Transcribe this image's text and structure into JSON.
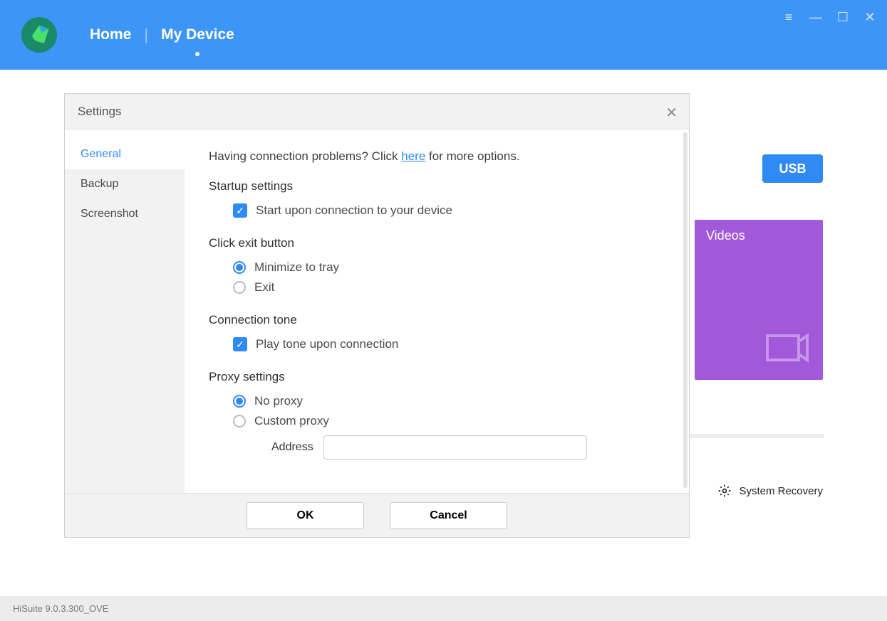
{
  "header": {
    "nav": {
      "home": "Home",
      "my_device": "My Device"
    }
  },
  "background": {
    "usb_button": "USB",
    "videos_label": "Videos",
    "system_recovery": "System Recovery"
  },
  "statusbar": {
    "version": "HiSuite 9.0.3.300_OVE"
  },
  "dialog": {
    "title": "Settings",
    "sidebar": {
      "general": "General",
      "backup": "Backup",
      "screenshot": "Screenshot"
    },
    "help": {
      "prefix": "Having connection problems? Click ",
      "link": "here",
      "suffix": " for more options."
    },
    "sections": {
      "startup": {
        "title": "Startup settings",
        "start_on_connect": "Start upon connection to your device"
      },
      "exit": {
        "title": "Click exit button",
        "minimize": "Minimize to tray",
        "exit": "Exit"
      },
      "tone": {
        "title": "Connection tone",
        "play": "Play tone upon connection"
      },
      "proxy": {
        "title": "Proxy settings",
        "no_proxy": "No proxy",
        "custom": "Custom proxy",
        "address_label": "Address",
        "address_value": ""
      }
    },
    "buttons": {
      "ok": "OK",
      "cancel": "Cancel"
    }
  }
}
